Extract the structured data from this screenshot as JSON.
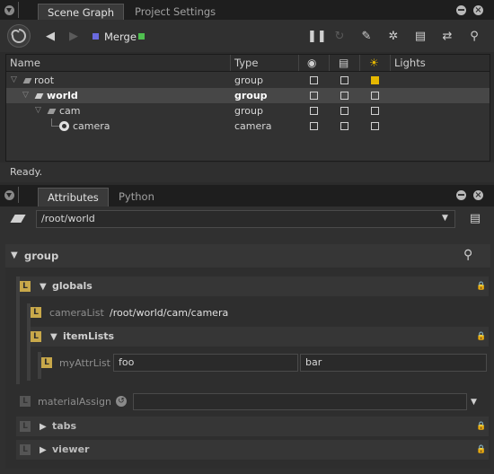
{
  "top_tabs": [
    "Scene Graph",
    "Project Settings"
  ],
  "toolbar": {
    "node_name": "Merge",
    "node_color_left": "#6a6adf",
    "node_color_right": "#4fbf4f"
  },
  "columns": [
    "Name",
    "Type",
    "",
    "",
    "",
    "Lights"
  ],
  "rows": [
    {
      "name": "root",
      "type": "group",
      "checks": [
        false,
        false,
        true
      ]
    },
    {
      "name": "world",
      "type": "group",
      "checks": [
        false,
        false,
        false
      ]
    },
    {
      "name": "cam",
      "type": "group",
      "checks": [
        false,
        false,
        false
      ]
    },
    {
      "name": "camera",
      "type": "camera",
      "checks": [
        false,
        false,
        false
      ]
    }
  ],
  "status": "Ready.",
  "bottom_tabs": [
    "Attributes",
    "Python"
  ],
  "path": "/root/world",
  "attrs": {
    "group_label": "group",
    "globals_label": "globals",
    "cameraList_label": "cameraList",
    "cameraList_value": "/root/world/cam/camera",
    "itemLists_label": "itemLists",
    "myAttrList_label": "myAttrList",
    "myAttrList_values": [
      "foo",
      "bar"
    ],
    "materialAssign_label": "materialAssign",
    "tabs_label": "tabs",
    "viewer_label": "viewer"
  },
  "colors": {
    "accent": "#e6b800",
    "background": "#2b2b2b"
  }
}
